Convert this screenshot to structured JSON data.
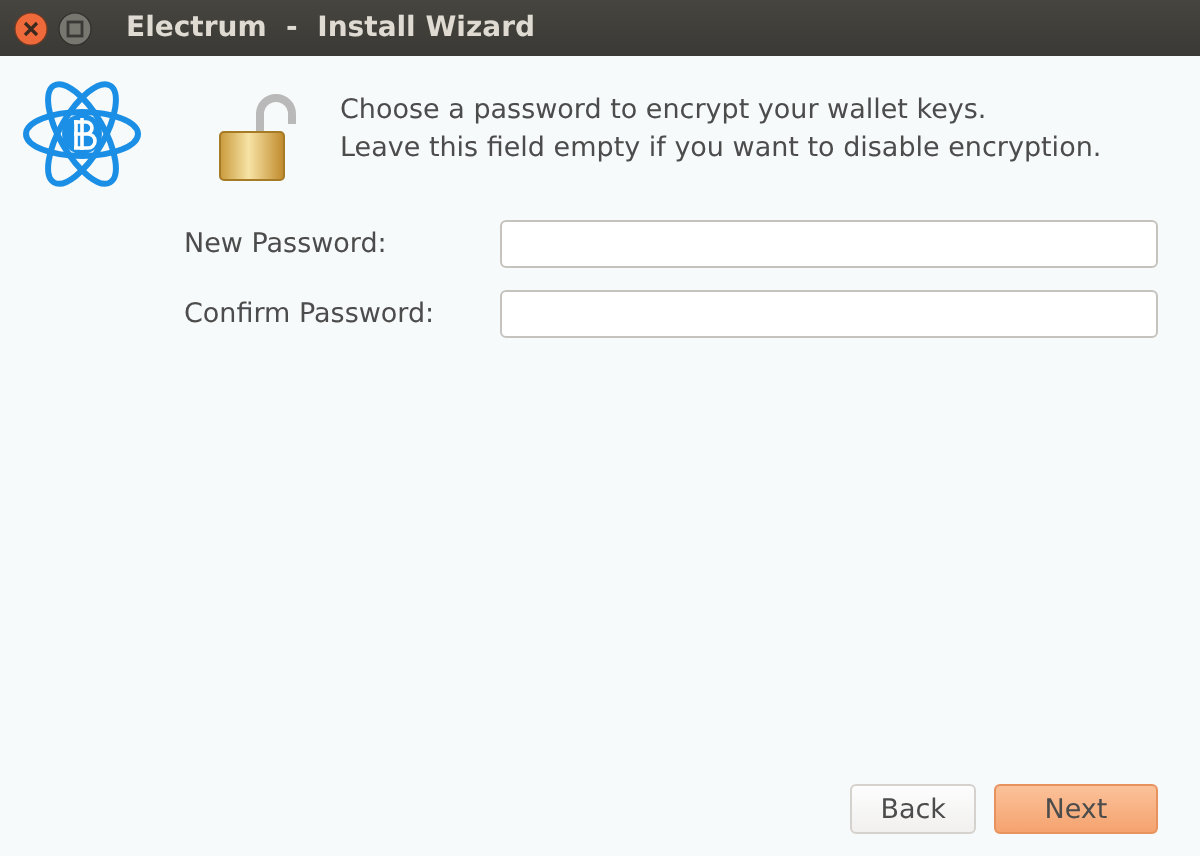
{
  "window": {
    "title": "Electrum  -  Install Wizard"
  },
  "message": "Choose a password to encrypt your wallet keys.\nLeave this field empty if you want to disable encryption.",
  "fields": [
    {
      "label": "New Password:"
    },
    {
      "label": "Confirm Password:"
    }
  ],
  "buttons": [
    {
      "label": "Back",
      "primary": false
    },
    {
      "label": "Next",
      "primary": true
    }
  ]
}
